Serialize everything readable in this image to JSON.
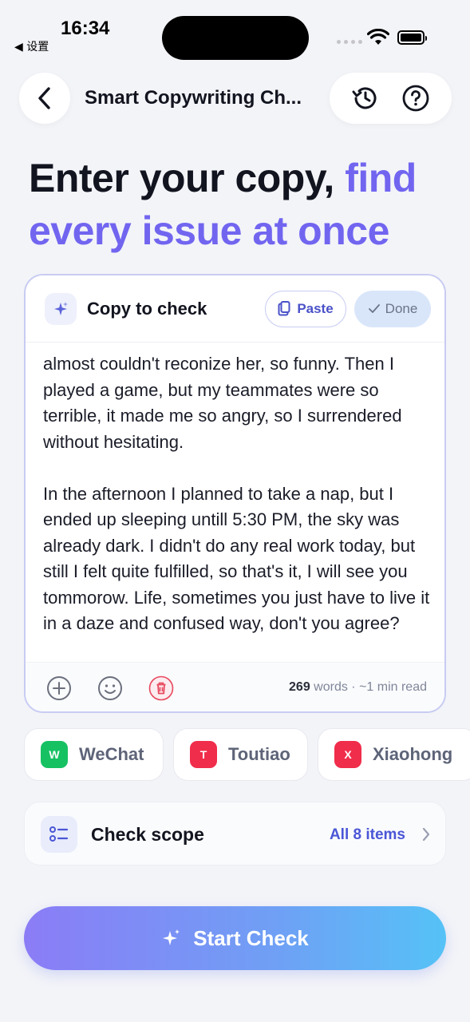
{
  "status_bar": {
    "time": "16:34",
    "back_app": "◀ 设置"
  },
  "nav": {
    "title": "Smart Copywriting Ch..."
  },
  "headline": {
    "dark": "Enter your copy, ",
    "accent_1": "find",
    "accent_2": "every issue at once"
  },
  "copy_card": {
    "title": "Copy to check",
    "paste_label": "Paste",
    "done_label": "Done",
    "paragraphs": [
      "almost couldn't reconize her, so funny. Then I played a game, but my teammates were so terrible, it made me so angry, so I surrendered without hesitating.",
      "In the afternoon I planned to take a nap, but I ended up sleeping untill 5:30 PM, the sky was already dark. I didn't do any real work today, but still I felt quite fulfilled, so that's it, I will see you tommorow. Life, sometimes you just have to live it in a daze and confused way, don't you agree?"
    ],
    "word_count": "269",
    "word_count_suffix": " words · ~1 min read"
  },
  "platforms": [
    {
      "letter": "W",
      "name": "WeChat",
      "color": "#16c162"
    },
    {
      "letter": "T",
      "name": "Toutiao",
      "color": "#f02d4b"
    },
    {
      "letter": "X",
      "name": "Xiaohong",
      "color": "#f02d4b"
    }
  ],
  "scope": {
    "label": "Check scope",
    "value": "All 8 items"
  },
  "cta": {
    "label": "Start Check"
  },
  "colors": {
    "accent": "#7165f0",
    "link": "#4a56d6",
    "wechat": "#16c162",
    "red": "#f02d4b"
  }
}
